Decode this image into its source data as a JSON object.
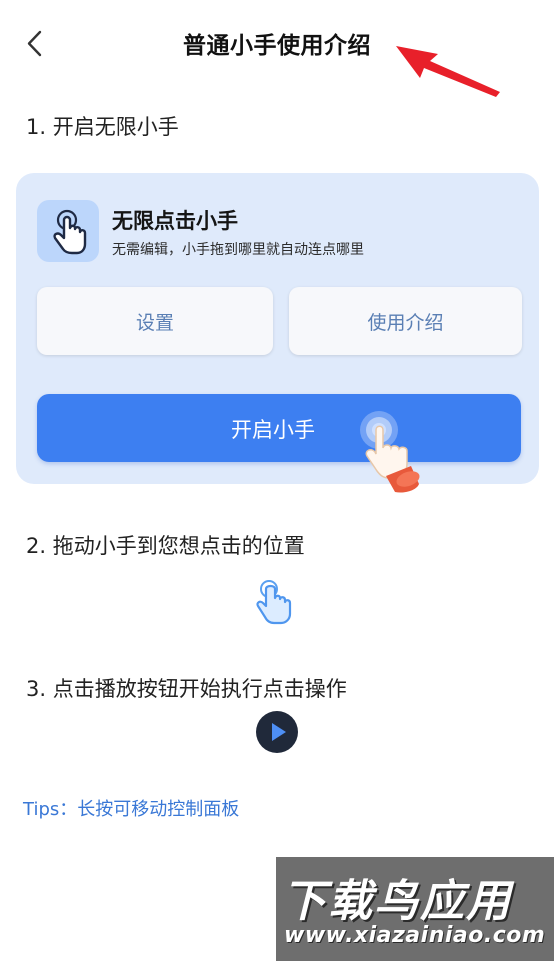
{
  "header": {
    "title": "普通小手使用介绍",
    "back_icon": "chevron-left-icon"
  },
  "steps": [
    {
      "label": "1. 开启无限小手"
    },
    {
      "label": "2. 拖动小手到您想点击的位置"
    },
    {
      "label": "3. 点击播放按钮开始执行点击操作"
    }
  ],
  "card": {
    "title": "无限点击小手",
    "subtitle": "无需编辑，小手拖到哪里就自动连点哪里",
    "settings_label": "设置",
    "intro_label": "使用介绍",
    "start_label": "开启小手"
  },
  "tips": "Tips：长按可移动控制面板",
  "watermark": {
    "main": "下载鸟应用",
    "url": "www.xiazainiao.com"
  },
  "colors": {
    "accent": "#3d7ff1",
    "card_bg": "#dfeafb",
    "tips": "#3a78d6",
    "arrow": "#e8202a"
  }
}
